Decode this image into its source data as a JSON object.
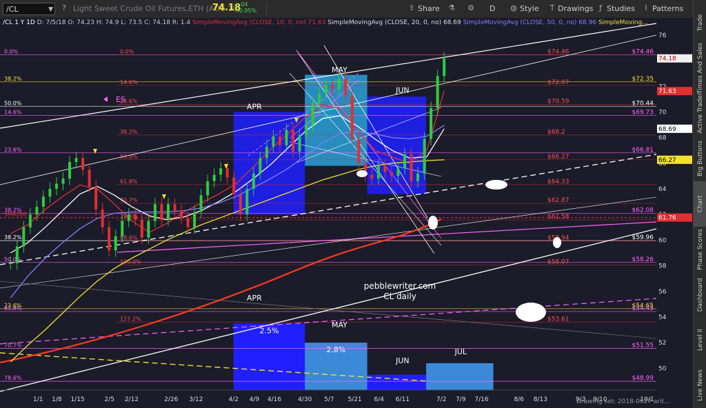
{
  "toolbar": {
    "symbol": "/CL",
    "description": "Light Sweet Crude Oil Futures,ETH (AUG 18)",
    "last_price": "74.18",
    "change": "+.04",
    "change_pct": "+0.05%",
    "share_label": "Share",
    "period_label": "D",
    "style_label": "Style",
    "drawings_label": "Drawings",
    "studies_label": "Studies",
    "patterns_label": "Patterns"
  },
  "header": {
    "info": "/CL 1 Y 1D",
    "ohlc": "D: 7/5/18  O: 74.23  H: 74.9  L: 73.5  C: 74.18  R: 1.4",
    "sma10": "SimpleMovingAvg (CLOSE, 10, 0, no)",
    "sma10_val": "71.63",
    "sma20": "SimpleMovingAvg (CLOSE, 20, 0, no)",
    "sma20_val": "68.69",
    "sma50": "SimpleMovingAvg (CLOSE, 50, 0, no)",
    "sma50_val": "68.96",
    "sma200": "SimpleMoving...",
    "colors": {
      "sma10": "#e03030",
      "sma20": "#ffffff",
      "sma50": "#8080ff",
      "sma200": "#f0e130"
    }
  },
  "right_sidebar": {
    "tabs": [
      "Trade",
      "Times And Sales",
      "Active Trader",
      "Big Buttons",
      "Chart",
      "Phase Scores",
      "Dashboard",
      "Level II",
      "Live News"
    ],
    "active": "Chart"
  },
  "footer": {
    "drawing_set": "Drawing set: 2018-0627 arit..."
  },
  "chart_data": {
    "type": "line",
    "title": "",
    "watermark": "pebblewriter.com",
    "watermark_sub": "CL daily",
    "x_ticks": [
      "1/1",
      "1/8",
      "1/15",
      "2/5",
      "2/12",
      "2/26",
      "3/12",
      "4/2",
      "4/9",
      "4/16",
      "4/30",
      "5/7",
      "5/21",
      "6/4",
      "6/11",
      "7/2",
      "7/9",
      "7/16",
      "8/6",
      "8/13",
      "9/3",
      "9/10",
      "10/1"
    ],
    "y_ticks": [
      50,
      52,
      54,
      56,
      58,
      60,
      62,
      64,
      66,
      68,
      70,
      72,
      74,
      76
    ],
    "ylim": [
      48.3,
      76.8
    ],
    "price_badges": [
      {
        "value": "74.18",
        "y": 74.18,
        "bg": "#f0f0f0",
        "fg": "#c00000"
      },
      {
        "value": "71.63",
        "y": 71.63,
        "bg": "#e03030",
        "fg": "#ffffff"
      },
      {
        "value": "68.69",
        "y": 68.69,
        "bg": "#ffffff",
        "fg": "#000000"
      },
      {
        "value": "66.27",
        "y": 66.27,
        "bg": "#f0e130",
        "fg": "#000000"
      },
      {
        "value": "61.76",
        "y": 61.76,
        "bg": "#e03030",
        "fg": "#ffffff"
      }
    ],
    "fib_left": [
      {
        "label": "0.0%",
        "y": 74.46,
        "color": "#ff66ff"
      },
      {
        "label": "38.2%",
        "y": 72.35,
        "color": "#f0e130"
      },
      {
        "label": "50.0%",
        "y": 70.44,
        "color": "#ffffff"
      },
      {
        "label": "14.6%",
        "y": 69.73,
        "color": "#ff66ff"
      },
      {
        "label": "23.6%",
        "y": 66.81,
        "color": "#ff66ff"
      },
      {
        "label": "38.2%",
        "y": 62.08,
        "color": "#ff66ff"
      },
      {
        "label": "SMA200",
        "y": 61.76,
        "color": "#e03030"
      },
      {
        "label": "38.2%",
        "y": 59.96,
        "color": "#ffffff"
      },
      {
        "label": "50.0%",
        "y": 58.26,
        "color": "#ff66ff"
      },
      {
        "label": "23.6%",
        "y": 54.65,
        "color": "#f0e130"
      },
      {
        "label": "61.8%",
        "y": 54.43,
        "color": "#ff66ff"
      },
      {
        "label": "70.7%",
        "y": 51.55,
        "color": "#ff66ff"
      },
      {
        "label": "78.6%",
        "y": 48.99,
        "color": "#ff66ff"
      }
    ],
    "fib_right": [
      {
        "label": "$74.46",
        "y": 74.46,
        "color": "#ff66ff"
      },
      {
        "label": "$72.35",
        "y": 72.35,
        "color": "#f0e130"
      },
      {
        "label": "$70.44",
        "y": 70.44,
        "color": "#ffffff"
      },
      {
        "label": "$69.73",
        "y": 69.73,
        "color": "#ff66ff"
      },
      {
        "label": "$66.81",
        "y": 66.81,
        "color": "#ff66ff"
      },
      {
        "label": "$62.08",
        "y": 62.08,
        "color": "#ff66ff"
      },
      {
        "label": "$59.96",
        "y": 59.96,
        "color": "#ffffff"
      },
      {
        "label": "$58.26",
        "y": 58.26,
        "color": "#ff66ff"
      },
      {
        "label": "$54.65",
        "y": 54.65,
        "color": "#f0e130"
      },
      {
        "label": "$54.43",
        "y": 54.43,
        "color": "#ff66ff"
      },
      {
        "label": "$51.55",
        "y": 51.55,
        "color": "#ff66ff"
      },
      {
        "label": "$48.99",
        "y": 48.99,
        "color": "#ff66ff"
      }
    ],
    "fib_mid": [
      {
        "pct": "0.0%",
        "price": "$74.46",
        "y": 74.46
      },
      {
        "pct": "14.6%",
        "price": "$72.07",
        "y": 72.07
      },
      {
        "pct": "23.6%",
        "price": "$70.59",
        "y": 70.59
      },
      {
        "pct": "38.2%",
        "price": "$68.2",
        "y": 68.2
      },
      {
        "pct": "50.0%",
        "price": "$66.27",
        "y": 66.27
      },
      {
        "pct": "61.8%",
        "price": "$64.33",
        "y": 64.33
      },
      {
        "pct": "70.7%",
        "price": "$62.87",
        "y": 62.87
      },
      {
        "pct": "78.6%",
        "price": "$61.58",
        "y": 61.58
      },
      {
        "pct": "88.6%",
        "price": "$59.94",
        "y": 59.94
      },
      {
        "pct": "100.0%",
        "price": "$58.07",
        "y": 58.07
      },
      {
        "pct": "127.2%",
        "price": "$53.61",
        "y": 53.61
      }
    ],
    "month_labels": [
      {
        "text": "APR",
        "x": "4/9",
        "y": 70.2
      },
      {
        "text": "MAY",
        "x": "5/14",
        "y": 73.1
      },
      {
        "text": "JUN",
        "x": "6/11",
        "y": 71.5
      },
      {
        "text": "APR",
        "x": "4/9",
        "y": 55.3
      },
      {
        "text": "MAY",
        "x": "5/14",
        "y": 53.2
      },
      {
        "text": "JUN",
        "x": "6/11",
        "y": 50.4
      },
      {
        "text": "JUL",
        "x": "7/9",
        "y": 51.1
      }
    ],
    "volume_boxes": [
      {
        "label": "2.5%",
        "start": "4/2",
        "end": "4/30",
        "top": 53.5,
        "color": "#2020ff"
      },
      {
        "label": "2.8%",
        "start": "4/30",
        "end": "5/28",
        "top": 52.0,
        "color": "#3a8ad8"
      },
      {
        "label": "",
        "start": "5/28",
        "end": "6/25",
        "top": 49.5,
        "color": "#2020ff"
      },
      {
        "label": "",
        "start": "6/25",
        "end": "7/23",
        "top": 50.4,
        "color": "#3a8ad8"
      }
    ],
    "price_boxes": [
      {
        "start": "4/2",
        "end": "4/30",
        "top": 70.0,
        "bottom": 62.0,
        "color": "#2020ff"
      },
      {
        "start": "4/30",
        "end": "5/28",
        "top": 72.9,
        "bottom": 65.8,
        "color": "#2aa0d8"
      },
      {
        "start": "5/28",
        "end": "6/25",
        "top": 71.2,
        "bottom": 63.6,
        "color": "#2020ff"
      }
    ],
    "es_label": "ES",
    "series": [
      {
        "name": "SMA10",
        "color": "#e03030",
        "values": [
          60.5,
          61.2,
          62.4,
          63.4,
          64.3,
          64.0,
          62.8,
          61.5,
          60.6,
          61.3,
          62.2,
          62.9,
          63.6,
          64.4,
          65.7,
          67.1,
          68.3,
          69.6,
          70.5,
          70.3,
          68.6,
          67.0,
          66.5,
          66.0,
          67.0,
          71.63
        ]
      },
      {
        "name": "SMA20",
        "color": "#ffffff",
        "values": [
          59.0,
          59.8,
          61.0,
          62.3,
          63.6,
          64.2,
          63.5,
          62.6,
          61.9,
          61.6,
          61.8,
          62.3,
          63.0,
          63.8,
          64.8,
          65.9,
          67.2,
          68.5,
          69.5,
          69.7,
          68.9,
          67.9,
          67.0,
          66.4,
          66.5,
          68.69
        ]
      },
      {
        "name": "SMA50",
        "color": "#8080ff",
        "values": [
          55.5,
          57.2,
          58.6,
          59.8,
          60.9,
          61.7,
          62.1,
          62.2,
          62.2,
          62.2,
          62.3,
          62.5,
          62.9,
          63.4,
          64.1,
          64.8,
          65.6,
          66.6,
          67.6,
          68.3,
          68.5,
          68.3,
          68.0,
          67.9,
          68.1,
          68.96
        ]
      },
      {
        "name": "SMA200",
        "color": "#f0e130",
        "values": [
          50.5,
          51.8,
          53.0,
          54.3,
          55.6,
          56.8,
          57.8,
          58.6,
          59.3,
          60.0,
          60.6,
          61.2,
          61.7,
          62.2,
          62.7,
          63.2,
          63.7,
          64.2,
          64.7,
          65.1,
          65.5,
          65.8,
          66.0,
          66.1,
          66.2,
          66.27
        ]
      }
    ],
    "closes": [
      58.2,
      59.5,
      61.0,
      62.0,
      62.6,
      63.4,
      64.0,
      64.4,
      64.8,
      66.1,
      66.4,
      65.5,
      64.2,
      62.4,
      61.0,
      59.2,
      60.3,
      61.5,
      62.0,
      61.6,
      60.2,
      61.5,
      62.8,
      61.6,
      62.8,
      62.3,
      61.7,
      61.0,
      62.2,
      63.5,
      64.6,
      65.1,
      65.6,
      64.9,
      63.6,
      62.0,
      64.0,
      65.2,
      66.4,
      67.3,
      68.1,
      67.4,
      68.6,
      66.9,
      68.2,
      69.0,
      70.7,
      71.4,
      72.1,
      71.8,
      72.6,
      71.3,
      67.9,
      66.0,
      65.1,
      64.8,
      65.8,
      65.3,
      65.0,
      65.6,
      66.7,
      64.6,
      65.2,
      67.9,
      70.3,
      72.8,
      74.18
    ]
  }
}
